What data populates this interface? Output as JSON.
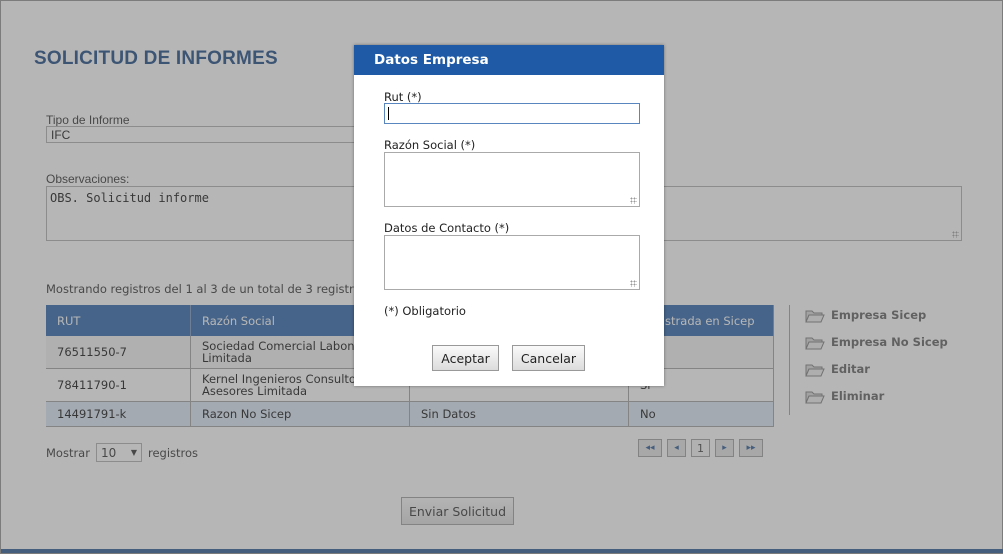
{
  "page": {
    "title": "SOLICITUD DE INFORMES",
    "tipo_label": "Tipo de Informe",
    "tipo_value": "IFC",
    "obs_label": "Observaciones:",
    "obs_value": "OBS. Solicitud informe",
    "records_info": "Mostrando registros del 1 al 3 de un total de 3 registros",
    "table": {
      "headers": [
        "RUT",
        "Razón Social",
        "",
        "Registrada en Sicep"
      ],
      "rows": [
        {
          "rut": "76511550-7",
          "razon": "Sociedad Comercial Labonorte Limitada",
          "datos": "",
          "sicep": ""
        },
        {
          "rut": "78411790-1",
          "razon": "Kernel Ingenieros Consultores Asesores Limitada",
          "datos": "",
          "sicep": "Si"
        },
        {
          "rut": "14491791-k",
          "razon": "Razon No Sicep",
          "datos": "Sin Datos",
          "sicep": "No"
        }
      ]
    },
    "actions": [
      {
        "label": "Empresa Sicep",
        "icon": "folder-open-icon"
      },
      {
        "label": "Empresa No Sicep",
        "icon": "folder-open-icon"
      },
      {
        "label": "Editar",
        "icon": "folder-open-icon"
      },
      {
        "label": "Eliminar",
        "icon": "folder-open-icon"
      }
    ],
    "mostrar_label": "Mostrar",
    "page_size": "10",
    "registros_label": "registros",
    "pager": {
      "first": "◂◂",
      "prev": "◂",
      "page": "1",
      "next": "▸",
      "last": "▸▸"
    },
    "submit_label": "Enviar Solicitud"
  },
  "modal": {
    "title": "Datos Empresa",
    "rut_label": "Rut (*)",
    "rut_value": "",
    "razon_label": "Razón Social (*)",
    "contacto_label": "Datos de Contacto (*)",
    "note": "(*) Obligatorio",
    "accept_label": "Aceptar",
    "cancel_label": "Cancelar"
  }
}
